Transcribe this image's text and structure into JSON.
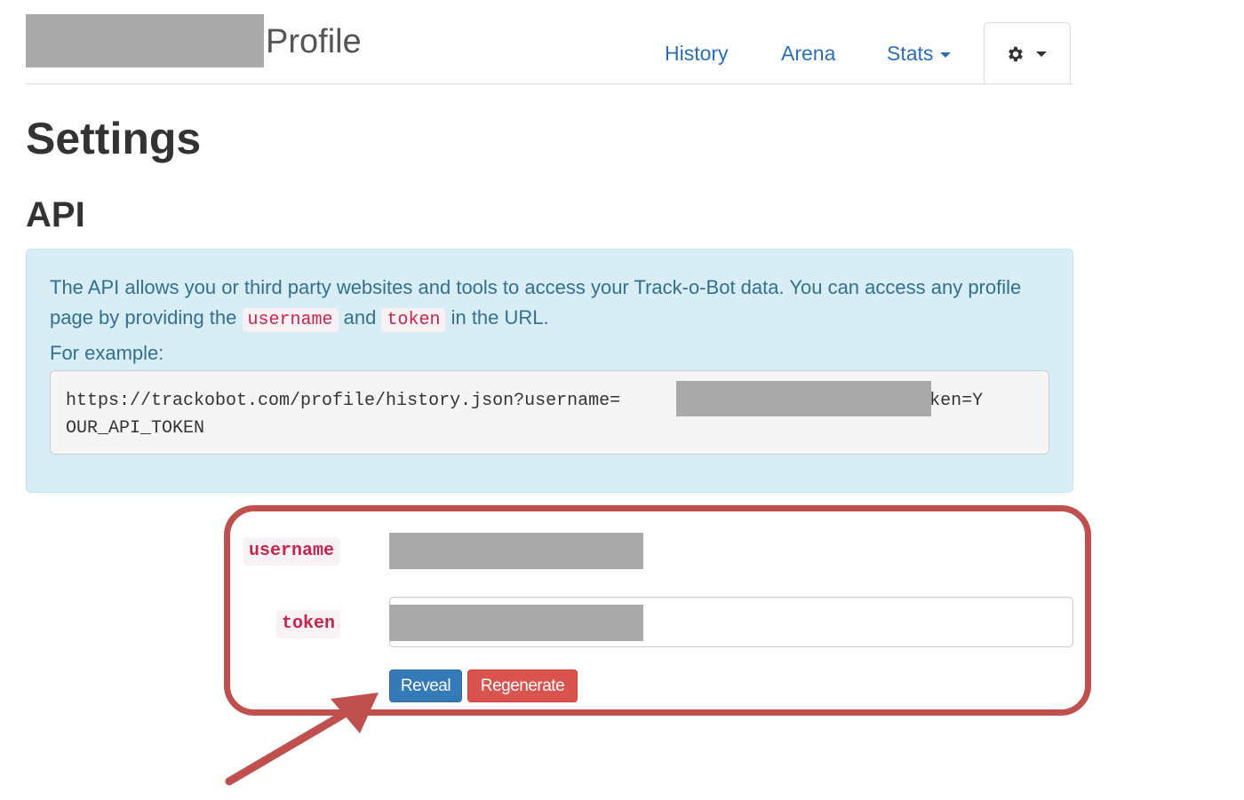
{
  "header": {
    "brand_title": "Profile",
    "nav": [
      {
        "label": "History"
      },
      {
        "label": "Arena"
      },
      {
        "label": "Stats"
      }
    ],
    "settings_menu_icon": "gear-icon"
  },
  "page": {
    "title": "Settings",
    "section_title": "API"
  },
  "info": {
    "text_before_username": "The API allows you or third party websites and tools to access your Track-o-Bot data. You can access any profile page by providing the ",
    "code_username": "username",
    "text_between": " and ",
    "code_token": "token",
    "text_after": " in the URL.",
    "example_label": "For example:",
    "example_url_line1": "https://trackobot.com/profile/history.json?username=                          &token=Y",
    "example_url_line2": "OUR_API_TOKEN"
  },
  "form": {
    "username_label": "username",
    "token_label": "token",
    "reveal_button": "Reveal",
    "regenerate_button": "Regenerate"
  },
  "colors": {
    "link": "#2a6fb5",
    "info_bg": "#d9edf7",
    "info_text": "#31708f",
    "code_text": "#c7254e",
    "reveal_bg": "#337ab7",
    "regenerate_bg": "#d9534f",
    "annotation": "#c0504d",
    "redaction": "#aaaaaa"
  }
}
